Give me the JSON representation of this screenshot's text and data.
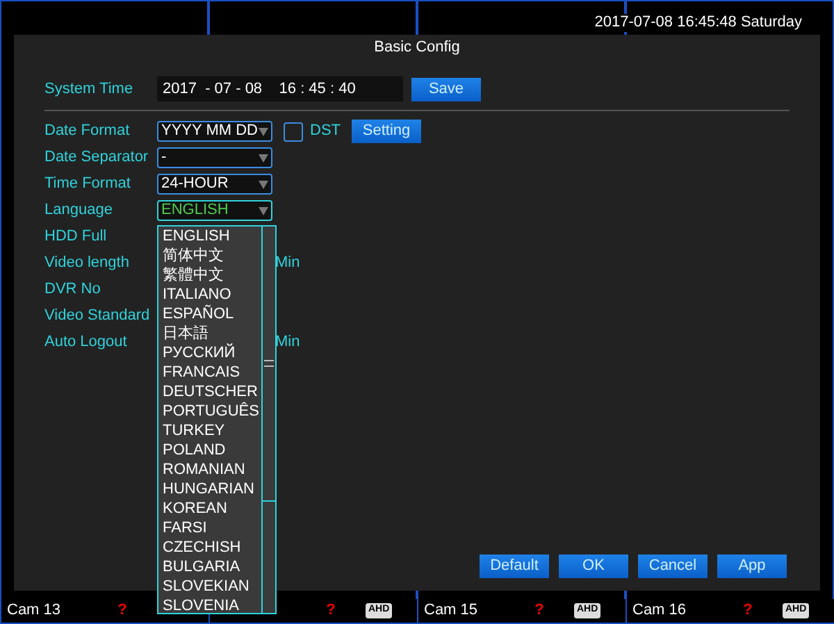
{
  "status_bar": {
    "datetime": "2017-07-08 16:45:48  Saturday"
  },
  "cameras": [
    {
      "name": "Cam 13",
      "status": "?"
    },
    {
      "status": "?",
      "badge": "AHD"
    },
    {
      "name": "Cam 15",
      "status": "?",
      "badge": "AHD"
    },
    {
      "name": "Cam 16",
      "status": "?",
      "badge": "AHD"
    }
  ],
  "dialog": {
    "title": "Basic Config",
    "system_time": {
      "label": "System Time",
      "value": "2017  - 07 - 08    16 : 45 : 40",
      "button": "Save"
    },
    "fields": [
      {
        "label": "Date Format",
        "kind": "select",
        "value": "YYYY MM DD",
        "focused": false,
        "dst": {
          "label": "DST",
          "checked": false
        },
        "button": "Setting"
      },
      {
        "label": "Date Separator",
        "kind": "select",
        "value": "-",
        "focused": false
      },
      {
        "label": "Time Format",
        "kind": "select",
        "value": "24-HOUR",
        "focused": false
      },
      {
        "label": "Language",
        "kind": "select",
        "value": "ENGLISH",
        "focused": true
      },
      {
        "label": "HDD Full",
        "kind": "hidden"
      },
      {
        "label": "Video length",
        "kind": "hidden",
        "unit": "Min"
      },
      {
        "label": "DVR No",
        "kind": "hidden"
      },
      {
        "label": "Video Standard",
        "kind": "hidden"
      },
      {
        "label": "Auto Logout",
        "kind": "hidden",
        "unit": "Min"
      }
    ],
    "dropdown": {
      "items": [
        {
          "label": "ENGLISH",
          "selected": false
        },
        {
          "label": "简体中文",
          "selected": false
        },
        {
          "label": "繁體中文",
          "selected": false
        },
        {
          "label": "ITALIANO",
          "selected": false
        },
        {
          "label": "ESPAÑOL",
          "selected": false
        },
        {
          "label": "日本語",
          "selected": false
        },
        {
          "label": "РУССКИЙ",
          "selected": false
        },
        {
          "label": "FRANCAIS",
          "selected": false
        },
        {
          "label": "DEUTSCHER",
          "selected": false
        },
        {
          "label": "PORTUGUÊS",
          "selected": false
        },
        {
          "label": "TURKEY",
          "selected": false
        },
        {
          "label": "POLAND",
          "selected": false
        },
        {
          "label": "ROMANIAN",
          "selected": false
        },
        {
          "label": "HUNGARIAN",
          "selected": false
        },
        {
          "label": "KOREAN",
          "selected": false
        },
        {
          "label": "FARSI",
          "selected": false
        },
        {
          "label": "CZECHISH",
          "selected": false
        },
        {
          "label": "BULGARIA",
          "selected": false
        },
        {
          "label": "SLOVEKIAN",
          "selected": false
        },
        {
          "label": "SLOVENIA",
          "selected": false
        }
      ]
    },
    "buttons": [
      "Default",
      "OK",
      "Cancel",
      "App"
    ]
  }
}
